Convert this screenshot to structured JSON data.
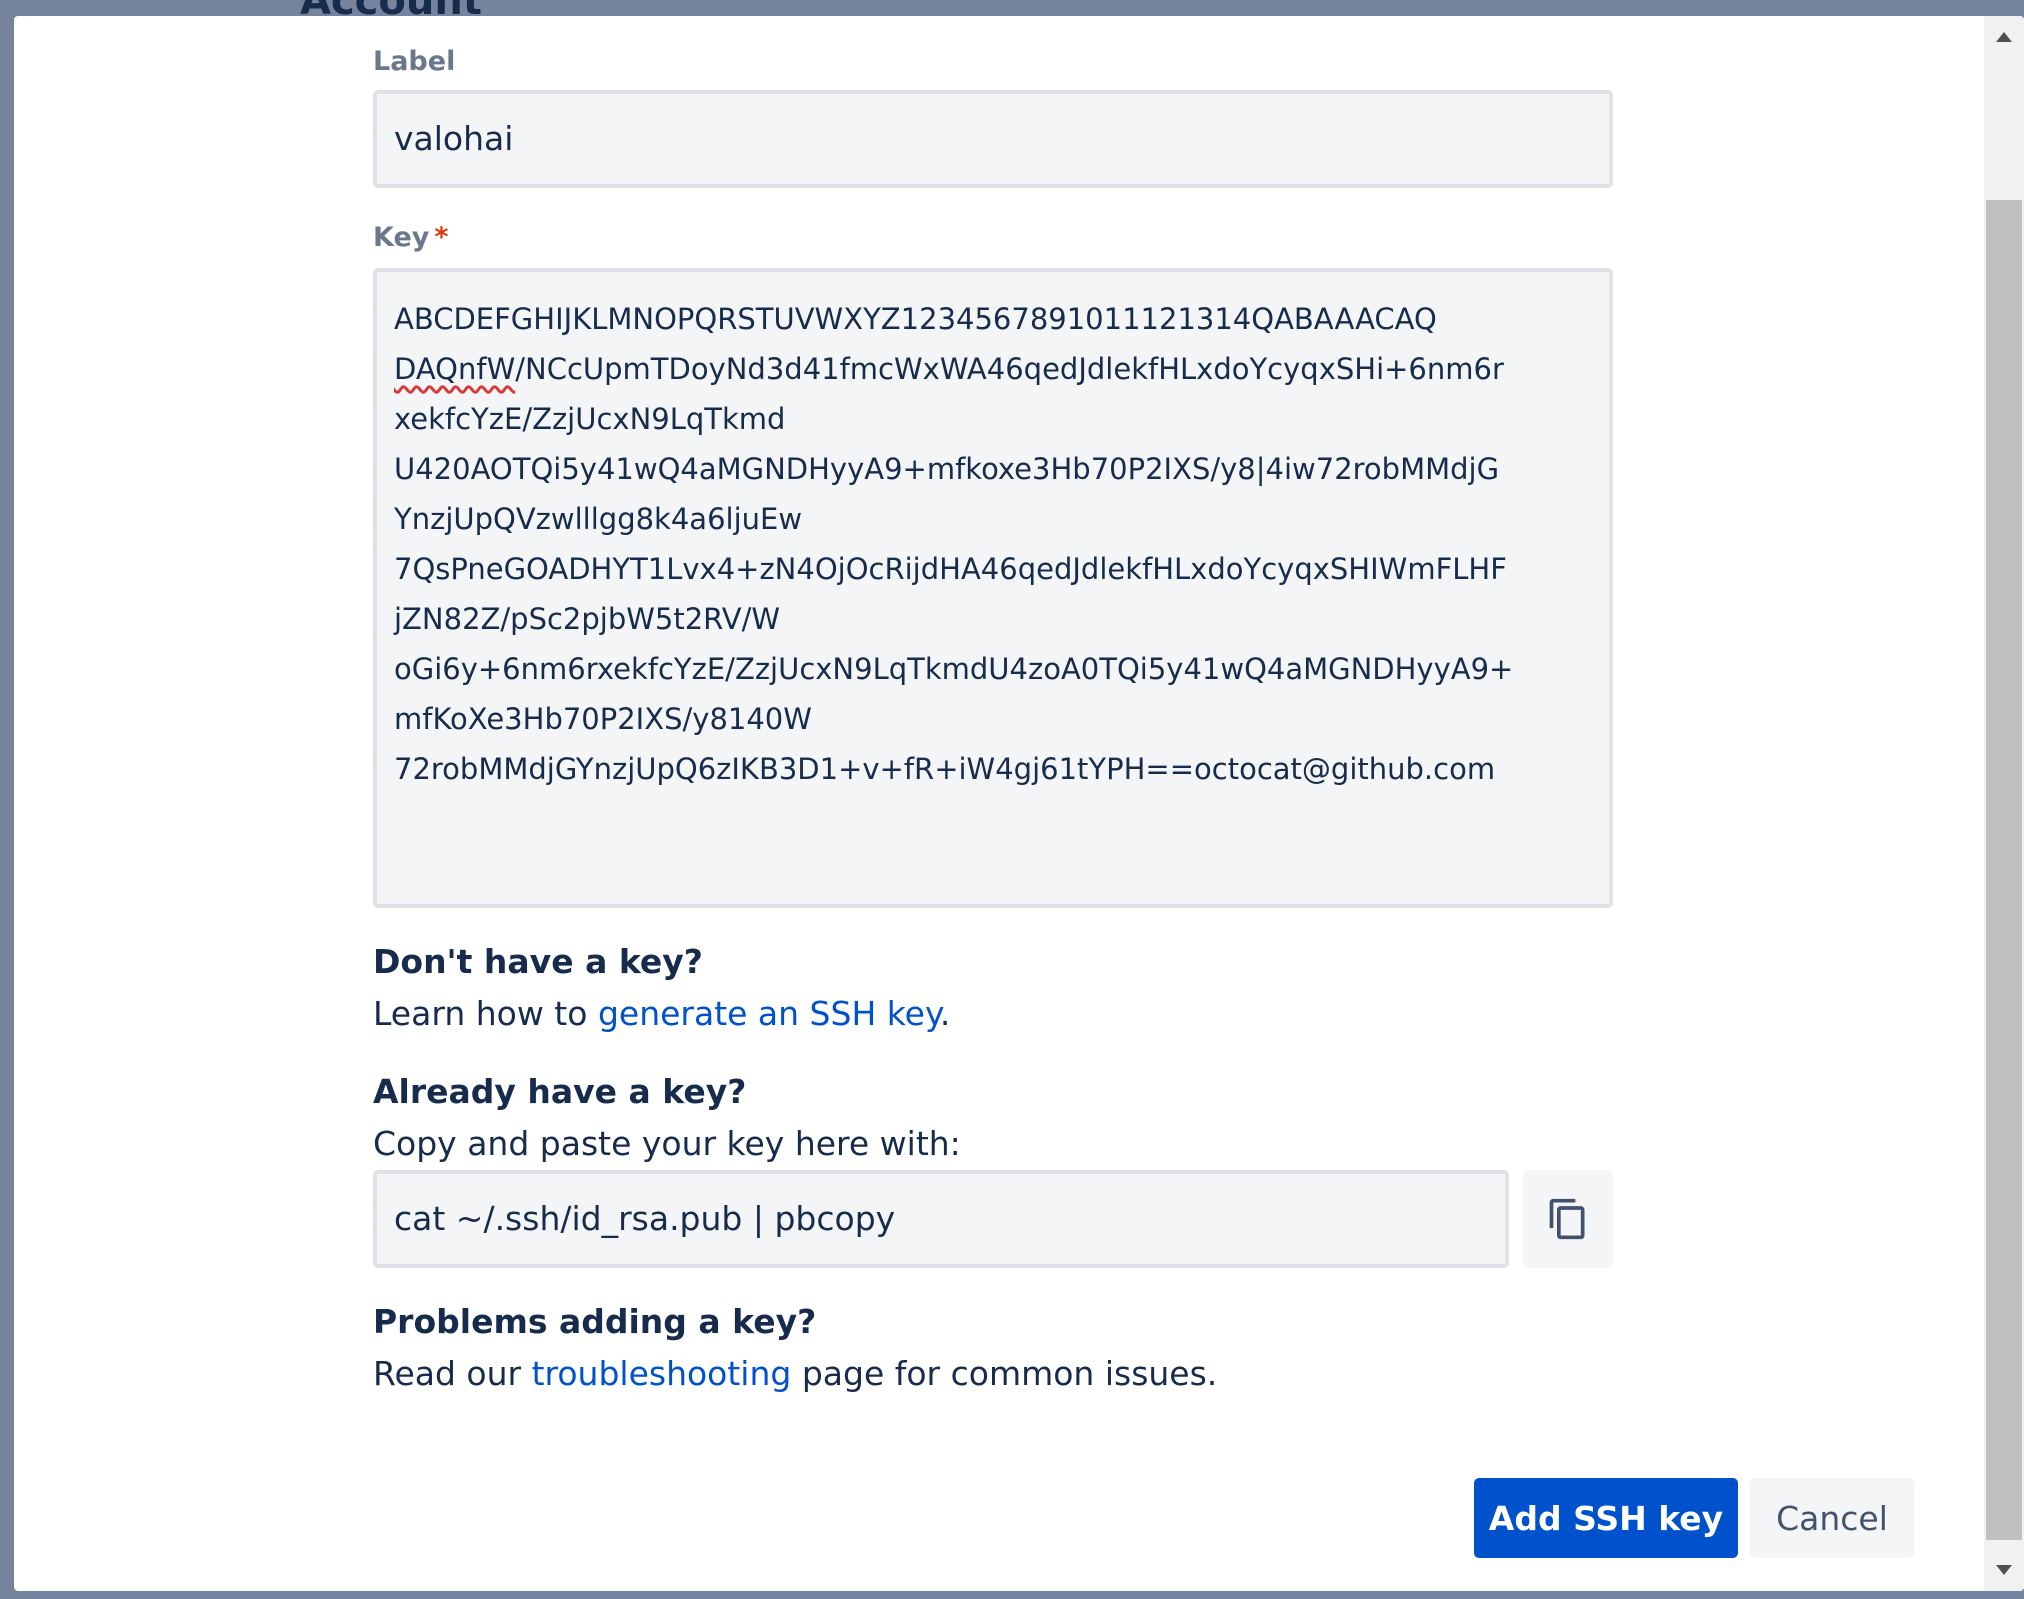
{
  "backdrop": {
    "title": "Account"
  },
  "form": {
    "label_field": {
      "label": "Label",
      "value": "valohai"
    },
    "key_field": {
      "label": "Key",
      "required_mark": "*",
      "lines": [
        "ABCDEFGHIJKLMNOPQRSTUVWXYZ123456789101112131​4QABAAACAQ",
        "DAQnfW",
        "/NCcUpmTDoyNd3d41fmcWxWA46qedJdlekfHLxdoYcyqxSHi+6nm6r",
        "xekfcYzE/ZzjUcxN9LqTkmd",
        "U420AOTQi5y41wQ4aMGNDHyyA9+mfkoxe3Hb70P2IXS/y8|4iw72robMMdjG",
        "YnzjUpQVzwlllgg8k4a6ljuEw",
        "7QsPneGOADHYT1Lvx4+zN4OjOcRijdHA46qedJdlekfHLxdoYcyqxSHIWmFLHF",
        "jZN82Z/pSc2pjbW5t2RV/W",
        "oGi6y+6nm6rxekfcYzE/ZzjUcxN9LqTkmdU4zoA0TQi5y41wQ4aMGNDHyyA9+",
        "mfKoXe3Hb70P2IXS/y8140W",
        "72robMMdjGYnzjUpQ6zIKB3D1+v+fR+iW4gj61tYPH==octocat@github.com"
      ]
    }
  },
  "help": {
    "no_key": {
      "heading": "Don't have a key?",
      "text_before": "Learn how to ",
      "link": "generate an SSH key",
      "text_after": "."
    },
    "have_key": {
      "heading": "Already have a key?",
      "text": "Copy and paste your key here with:",
      "command": "cat ~/.ssh/id_rsa.pub | pbcopy",
      "copy_icon": "copy-icon"
    },
    "problems": {
      "heading": "Problems adding a key?",
      "text_before": "Read our ",
      "link": "troubleshooting",
      "text_after": " page for common issues."
    }
  },
  "actions": {
    "primary": "Add SSH key",
    "secondary": "Cancel"
  },
  "colors": {
    "primary": "#0052cc",
    "link": "#0052cc",
    "required": "#de350b",
    "text": "#172b4d",
    "overlay": "#75839c"
  }
}
